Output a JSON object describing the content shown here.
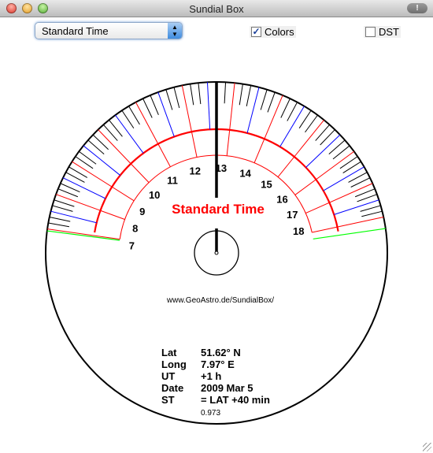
{
  "window": {
    "title": "Sundial Box",
    "alert_icon": "warning-icon",
    "alert_glyph": "!"
  },
  "toolbar": {
    "mode_select": {
      "value": "Standard Time"
    },
    "colors_checkbox": {
      "label": "Colors",
      "checked": true,
      "mark": "✓"
    },
    "dst_checkbox": {
      "label": "DST",
      "checked": false
    }
  },
  "dial": {
    "mode_label": "Standard Time",
    "url": "www.GeoAstro.de/SundialBox/",
    "hours": [
      "7",
      "8",
      "9",
      "10",
      "11",
      "12",
      "13",
      "14",
      "15",
      "16",
      "17",
      "18"
    ],
    "colors": {
      "hour_line": "#ff0000",
      "half_hour_line": "#0000ff",
      "sun_rise_set_line": "#00ff00",
      "ticks": "#000000"
    }
  },
  "info": {
    "rows": [
      {
        "label": "Lat",
        "value": "51.62° N"
      },
      {
        "label": "Long",
        "value": "7.97° E"
      },
      {
        "label": "UT",
        "value": "+1 h"
      },
      {
        "label": "Date",
        "value": "2009 Mar 5"
      },
      {
        "label": "ST",
        "value": "= LAT +40 min"
      }
    ],
    "footnote": "0.973"
  }
}
